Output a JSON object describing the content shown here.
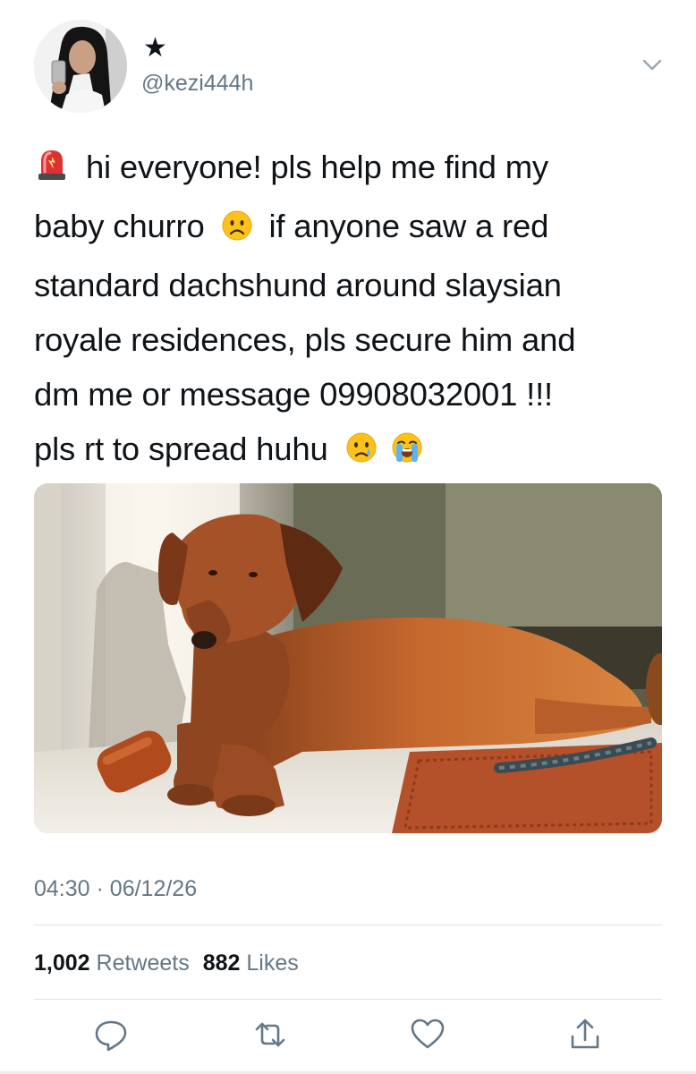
{
  "tweet": {
    "display_name": "★",
    "handle": "@kezi444h",
    "text_lines": [
      "hi everyone! pls help me find my",
      "baby churro",
      "if anyone saw a red",
      "standard dachshund around slaysian",
      "royale residences, pls secure him and",
      "dm me or message 09908032001 !!!",
      "pls rt to spread huhu"
    ],
    "emojis": [
      "siren-emoji",
      "frowning-face-emoji",
      "crying-face-emoji",
      "loudly-crying-face-emoji"
    ],
    "time": "04:30",
    "separator": "·",
    "date": "06/12/26",
    "retweets_count": "1,002",
    "retweets_label": "Retweets",
    "likes_count": "882",
    "likes_label": "Likes"
  },
  "actions": {
    "reply": "reply-icon",
    "retweet": "retweet-icon",
    "like": "heart-icon",
    "share": "share-icon"
  },
  "colors": {
    "text": "#0f1419",
    "secondary": "#657786",
    "divider": "#dfe3e6"
  }
}
